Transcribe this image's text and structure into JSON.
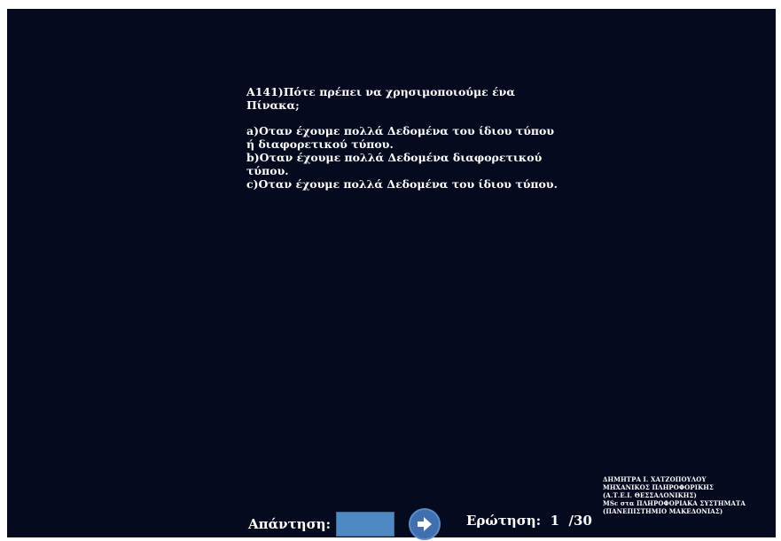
{
  "question": {
    "title": "Α141)Πότε πρέπει να χρησιμοποιούμε ένα Πίνακα;",
    "options": [
      "a)Οταν έχουμε πολλά Δεδομένα του ίδιου τύπου ή διαφορετικού τύπου.",
      "b)Οταν έχουμε πολλά Δεδομένα διαφορετικού τύπου.",
      "c)Οταν έχουμε πολλά Δεδομένα του ίδιου τύπου."
    ]
  },
  "answer": {
    "label": "Απάντηση:",
    "value": ""
  },
  "navigation": {
    "next_icon": "arrow-right-icon"
  },
  "progress": {
    "label": "Ερώτηση:",
    "current": "1",
    "total": "/30"
  },
  "credits": [
    "ΔΗΜΗΤΡΑ Ι. ΧΑΤΖΟΠΟΥΛΟΥ",
    "ΜΗΧΑΝΙΚΟΣ ΠΛΗΡΟΦΟΡΙΚΗΣ",
    "(Α.Τ.Ε.Ι. ΘΕΣΣΑΛΟΝΙΚΗΣ)",
    "MSc στα ΠΛΗΡΟΦΟΡΙΑΚΑ ΣΥΣΤΗΜΑΤΑ",
    "(ΠΑΝΕΠΙΣΤΗΜΙΟ ΜΑΚΕΔΟΝΙΑΣ)"
  ],
  "colors": {
    "background": "#050a1f",
    "text": "#ffffff",
    "input": "#4f89c4",
    "button": "#3f6fae"
  }
}
